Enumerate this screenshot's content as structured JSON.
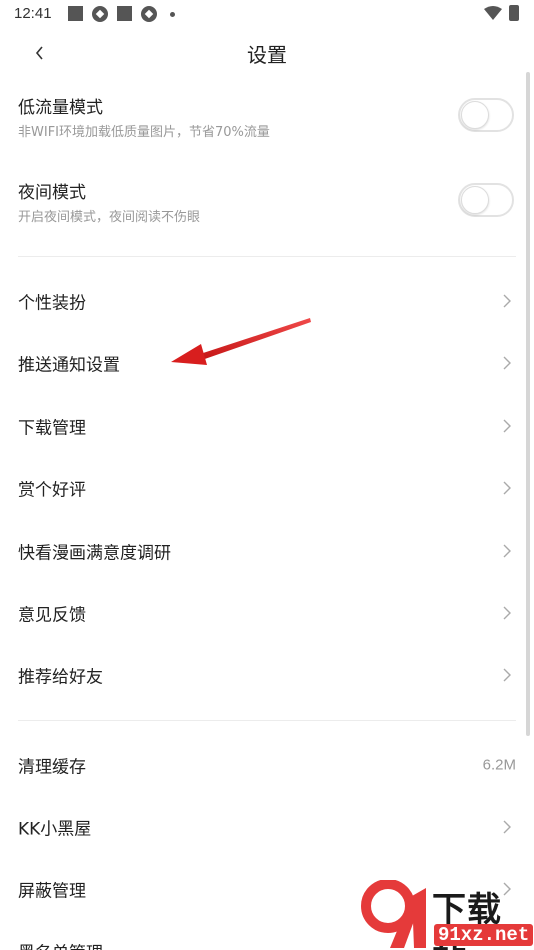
{
  "status_bar": {
    "time": "12:41"
  },
  "header": {
    "title": "设置"
  },
  "toggles": [
    {
      "title": "低流量模式",
      "subtitle": "非WIFI环境加载低质量图片，节省70%流量",
      "on": false
    },
    {
      "title": "夜间模式",
      "subtitle": "开启夜间模式，夜间阅读不伤眼",
      "on": false
    }
  ],
  "menu_group_1": [
    {
      "label": "个性装扮"
    },
    {
      "label": "推送通知设置"
    },
    {
      "label": "下载管理"
    },
    {
      "label": "赏个好评"
    },
    {
      "label": "快看漫画满意度调研"
    },
    {
      "label": "意见反馈"
    },
    {
      "label": "推荐给好友"
    }
  ],
  "menu_group_2": [
    {
      "label": "清理缓存",
      "value": "6.2M"
    },
    {
      "label": "KK小黑屋"
    },
    {
      "label": "屏蔽管理"
    },
    {
      "label": "黑名单管理"
    }
  ],
  "watermark": {
    "text": "下载站",
    "url": "91xz.net"
  },
  "colors": {
    "annotation_arrow": "#e02424",
    "watermark_red": "#e53a3a"
  }
}
